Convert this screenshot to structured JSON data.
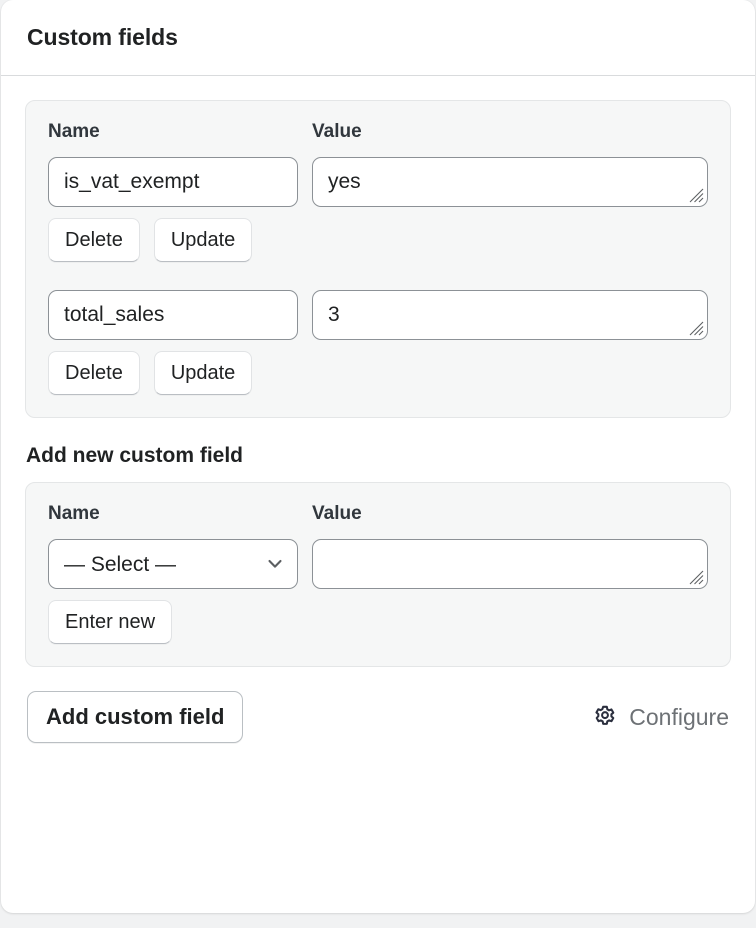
{
  "card": {
    "title": "Custom fields"
  },
  "existing_fields_panel": {
    "headers": {
      "name": "Name",
      "value": "Value"
    },
    "rows": [
      {
        "name": "is_vat_exempt",
        "value": "yes",
        "delete_label": "Delete",
        "update_label": "Update"
      },
      {
        "name": "total_sales",
        "value": "3",
        "delete_label": "Delete",
        "update_label": "Update"
      }
    ]
  },
  "add_new_section": {
    "label": "Add new custom field",
    "headers": {
      "name": "Name",
      "value": "Value"
    },
    "name_select": {
      "selected": "— Select —",
      "options": [
        "— Select —"
      ]
    },
    "value_input": {
      "value": "",
      "placeholder": ""
    },
    "enter_new_label": "Enter new"
  },
  "footer": {
    "add_button_label": "Add custom field",
    "configure_label": "Configure",
    "gear_icon": "gear-icon",
    "gear_icon_color": "#2b2f3e"
  },
  "icons": {
    "chevron_down": "chevron-down-icon",
    "resize_grip": "resize-grip-icon"
  },
  "colors": {
    "page_background": "#f1f2f3",
    "card_background": "#ffffff",
    "panel_background": "#f6f7f7",
    "text_primary": "#202223",
    "text_secondary": "#6d7175",
    "border": "#8c9196"
  }
}
